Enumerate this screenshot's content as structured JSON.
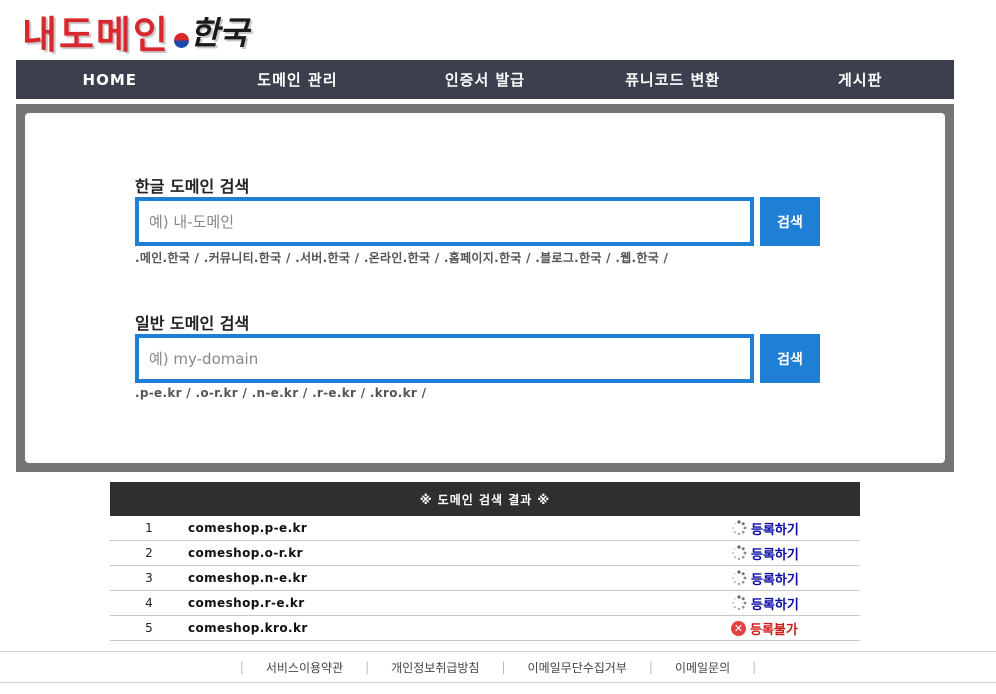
{
  "logo": {
    "part1": "내도메인",
    "part2": "한국"
  },
  "nav": [
    {
      "label": "HOME"
    },
    {
      "label": "도메인 관리"
    },
    {
      "label": "인증서 발급"
    },
    {
      "label": "퓨니코드 변환"
    },
    {
      "label": "게시판"
    }
  ],
  "korean_search": {
    "title": "한글 도메인 검색",
    "placeholder": "예) 내-도메인",
    "button": "검색",
    "tlds": ".메인.한국 / .커뮤니티.한국 / .서버.한국 / .온라인.한국 / .홈페이지.한국 / .블로그.한국 / .웹.한국 /"
  },
  "general_search": {
    "title": "일반 도메인 검색",
    "placeholder": "예) my-domain",
    "button": "검색",
    "tlds": ".p-e.kr / .o-r.kr / .n-e.kr / .r-e.kr / .kro.kr /"
  },
  "results": {
    "header": "※ 도메인 검색 결과 ※",
    "rows": [
      {
        "num": "1",
        "domain": "comeshop.p-e.kr",
        "status": "등록하기"
      },
      {
        "num": "2",
        "domain": "comeshop.o-r.kr",
        "status": "등록하기"
      },
      {
        "num": "3",
        "domain": "comeshop.n-e.kr",
        "status": "등록하기"
      },
      {
        "num": "4",
        "domain": "comeshop.r-e.kr",
        "status": "등록하기"
      },
      {
        "num": "5",
        "domain": "comeshop.kro.kr",
        "status": "등록불가"
      }
    ]
  },
  "footer": [
    "서비스이용약관",
    "개인정보취급방침",
    "이메일무단수집거부",
    "이메일문의"
  ],
  "colors": {
    "nav_bg": "#3c404e",
    "accent": "#1f7fd4",
    "ok": "#0a0aa8",
    "no": "#d01818"
  }
}
